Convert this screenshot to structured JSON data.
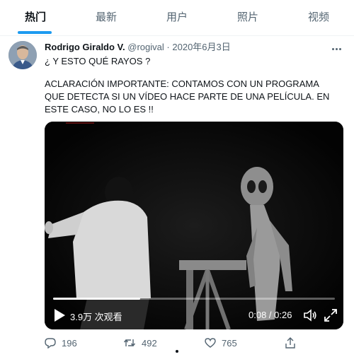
{
  "tabs": [
    {
      "label": "热门",
      "active": true
    },
    {
      "label": "最新",
      "active": false
    },
    {
      "label": "用户",
      "active": false
    },
    {
      "label": "照片",
      "active": false
    },
    {
      "label": "视频",
      "active": false
    }
  ],
  "tweet": {
    "author_name": "Rodrigo Giraldo V.",
    "handle": "@rogival",
    "separator": "·",
    "date": "2020年6月3日",
    "text_line1": "¿ Y ESTO QUÉ RAYOS ?",
    "text_body": "ACLARACIÓN IMPORTANTE: CONTAMOS CON UN PROGRAMA QUE DETECTA SI UN VÍDEO HACE PARTE DE UNA PELÍCULA.  EN ESTE CASO, NO LO ES  !!",
    "more_icon": "more-dots-icon"
  },
  "video": {
    "views": "3.9万 次观看",
    "time": "0:08 / 0:26",
    "progress": 0.31,
    "icons": [
      "play-icon",
      "volume-icon",
      "fullscreen-icon"
    ]
  },
  "actions": {
    "replies": "196",
    "retweets": "492",
    "likes": "765",
    "icons": [
      "reply-icon",
      "retweet-icon",
      "like-icon",
      "share-icon"
    ]
  },
  "colors": {
    "accent": "#1d9bf0",
    "text": "#0f1419",
    "muted": "#536471"
  }
}
